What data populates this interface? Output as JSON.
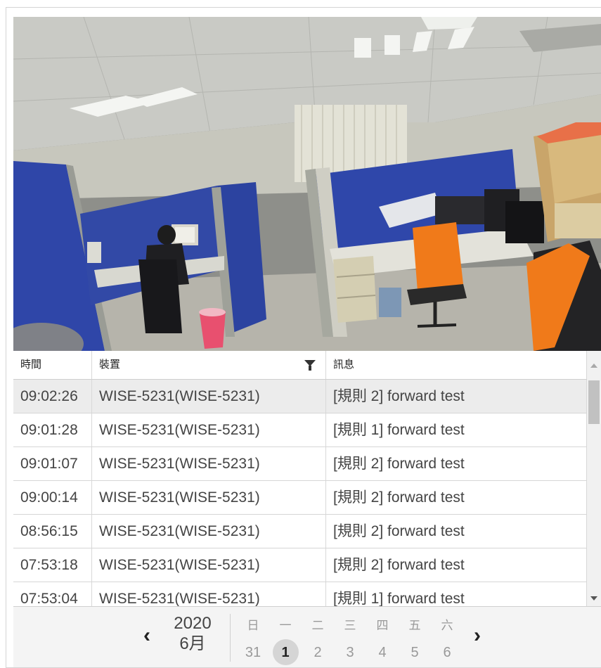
{
  "table": {
    "headers": {
      "time": "時間",
      "device": "裝置",
      "message": "訊息"
    },
    "rows": [
      {
        "time": "09:02:26",
        "device": "WISE-5231(WISE-5231)",
        "message": "[規則 2] forward test"
      },
      {
        "time": "09:01:28",
        "device": "WISE-5231(WISE-5231)",
        "message": "[規則 1] forward test"
      },
      {
        "time": "09:01:07",
        "device": "WISE-5231(WISE-5231)",
        "message": "[規則 2] forward test"
      },
      {
        "time": "09:00:14",
        "device": "WISE-5231(WISE-5231)",
        "message": "[規則 2] forward test"
      },
      {
        "time": "08:56:15",
        "device": "WISE-5231(WISE-5231)",
        "message": "[規則 2] forward test"
      },
      {
        "time": "07:53:18",
        "device": "WISE-5231(WISE-5231)",
        "message": "[規則 2] forward test"
      },
      {
        "time": "07:53:04",
        "device": "WISE-5231(WISE-5231)",
        "message": "[規則 1] forward test"
      }
    ]
  },
  "calendar": {
    "year": "2020",
    "month": "6月",
    "weekdays": [
      "日",
      "一",
      "二",
      "三",
      "四",
      "五",
      "六"
    ],
    "days": [
      "31",
      "1",
      "2",
      "3",
      "4",
      "5",
      "6"
    ],
    "prev_icon": "chevron-left-icon",
    "next_icon": "chevron-right-icon"
  },
  "colors": {
    "partition_blue": "#2f46a8",
    "chair_orange": "#f07a1a",
    "selected_row": "#ececec"
  }
}
